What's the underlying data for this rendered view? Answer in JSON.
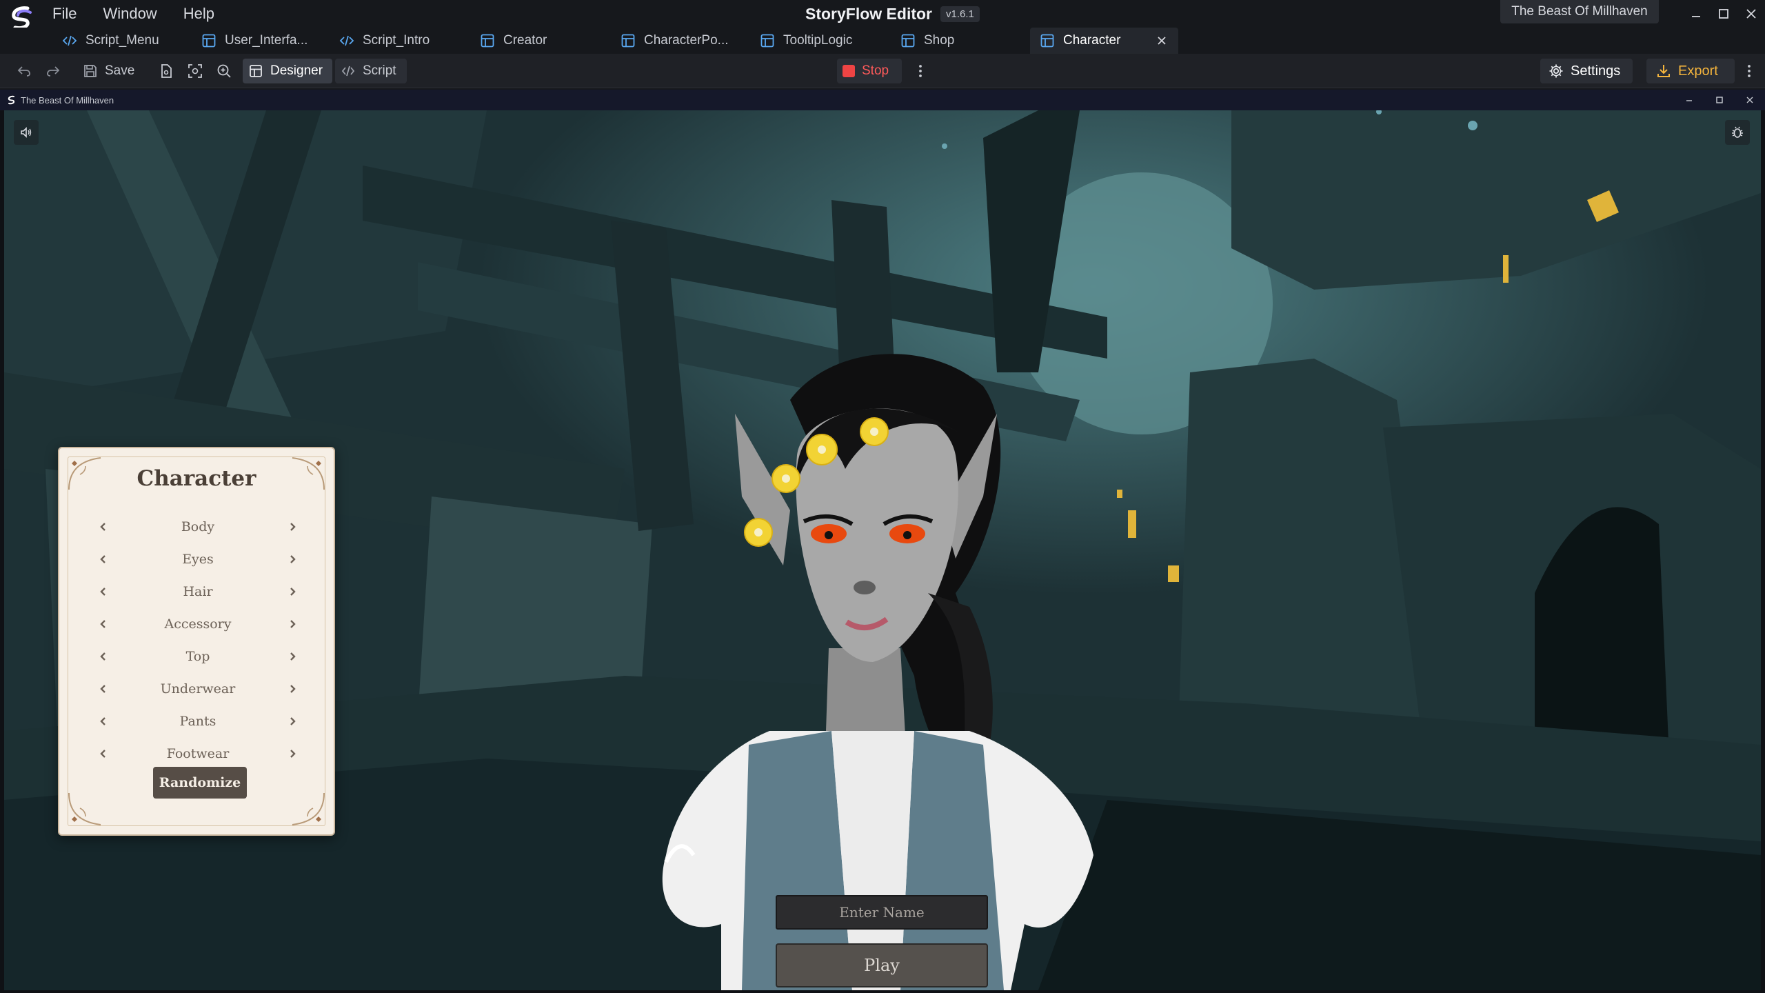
{
  "menu": [
    "File",
    "Window",
    "Help"
  ],
  "app": {
    "title": "StoryFlow Editor",
    "version": "v1.6.1",
    "project": "The Beast Of Millhaven"
  },
  "tabs": [
    {
      "label": "Script_Menu",
      "icon": "code-icon"
    },
    {
      "label": "User_Interfa...",
      "icon": "layout-icon"
    },
    {
      "label": "Script_Intro",
      "icon": "code-icon"
    },
    {
      "label": "Creator",
      "icon": "layout-icon"
    },
    {
      "label": "CharacterPo...",
      "icon": "layout-icon"
    },
    {
      "label": "TooltipLogic",
      "icon": "layout-icon"
    },
    {
      "label": "Shop",
      "icon": "layout-icon"
    },
    {
      "label": "Character",
      "icon": "layout-icon",
      "active": true
    }
  ],
  "toolbar": {
    "save_label": "Save",
    "designer_label": "Designer",
    "script_label": "Script",
    "stop_label": "Stop",
    "settings_label": "Settings",
    "export_label": "Export"
  },
  "game": {
    "window_title": "The Beast Of Millhaven",
    "panel": {
      "title": "Character",
      "options": [
        "Body",
        "Eyes",
        "Hair",
        "Accessory",
        "Top",
        "Underwear",
        "Pants",
        "Footwear"
      ],
      "randomize_label": "Randomize"
    },
    "name_placeholder": "Enter Name",
    "play_label": "Play"
  },
  "colors": {
    "stop": "#ef4444",
    "export": "#f5b53d",
    "panel_bg": "#f6efe6",
    "scene": "#1c2f33"
  }
}
